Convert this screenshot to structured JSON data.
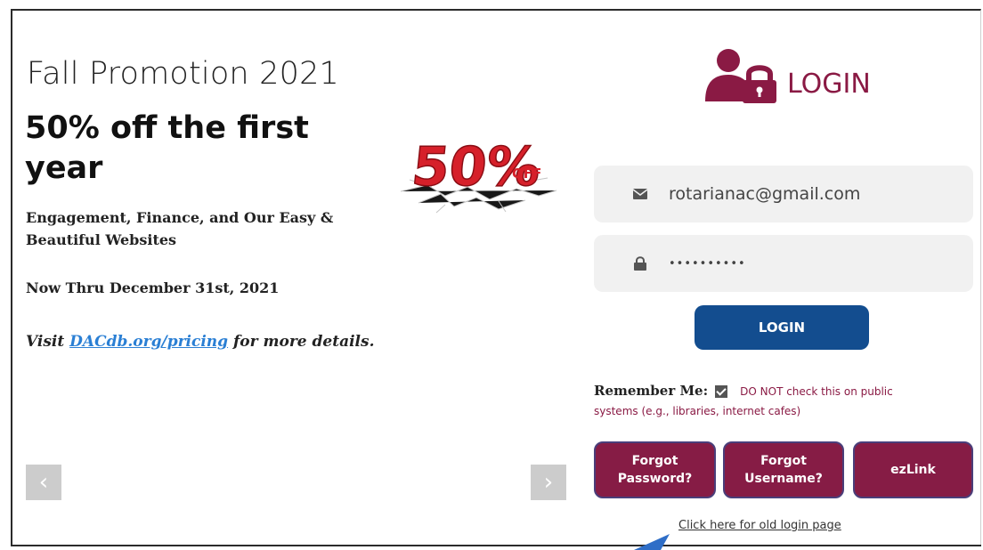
{
  "promo": {
    "heading": "Fall Promotion 2021",
    "headline": "50% off the first year",
    "subheading": "Engagement, Finance, and Our Easy & Beautiful Websites",
    "dates": "Now Thru December 31st, 2021",
    "visit_prefix": "Visit ",
    "visit_link": "DACdb.org/pricing",
    "visit_suffix": " for more details.",
    "badge_text": "50%",
    "badge_sub": "OFF",
    "prev_label": "‹",
    "next_label": "›"
  },
  "login": {
    "title": "LOGIN",
    "email_value": "rotarianac@gmail.com",
    "password_value": "••••••••••",
    "button_label": "LOGIN",
    "remember_label": "Remember Me:",
    "remember_checked": true,
    "warning_line1": "DO NOT check this on public",
    "warning_line2": "systems (e.g., libraries, internet cafes)",
    "forgot_password": "Forgot Password?",
    "forgot_username": "Forgot Username?",
    "ezlink": "ezLink",
    "old_login_link": "Click here for old login page"
  },
  "colors": {
    "brand": "#861c45",
    "login_button": "#134d8f",
    "link": "#2a7fd4"
  },
  "icons": {
    "login": "user-lock-icon",
    "email": "envelope-icon",
    "password": "lock-icon"
  }
}
